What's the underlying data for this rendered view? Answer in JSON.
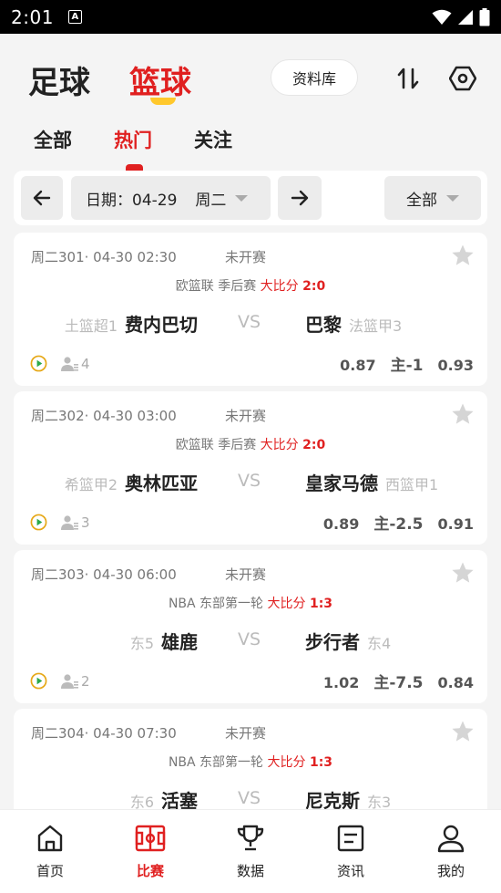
{
  "status_bar": {
    "time": "2:01",
    "notification_glyph": "A"
  },
  "header": {
    "sport_tabs": [
      {
        "label": "足球",
        "active": false
      },
      {
        "label": "篮球",
        "active": true
      }
    ],
    "database_button": "资料库",
    "icons": [
      "sort-icon",
      "settings-hexagon-icon"
    ],
    "sub_tabs": [
      {
        "label": "全部",
        "active": false
      },
      {
        "label": "热门",
        "active": true
      },
      {
        "label": "关注",
        "active": false
      }
    ]
  },
  "date_bar": {
    "date_label": "日期：04-29",
    "weekday": "周二",
    "filter": "全部"
  },
  "matches": [
    {
      "meta": "周二301· 04-30 02:30",
      "status": "未开赛",
      "league": "欧篮联 季后赛",
      "big_small_label": "大比分",
      "big_small_score": "2:0",
      "home_rank": "土篮超1",
      "home_team": "费内巴切",
      "vs": "VS",
      "away_team": "巴黎",
      "away_rank": "法篮甲3",
      "watchers": "4",
      "odds_home": "0.87",
      "handicap_prefix": "主",
      "handicap": "-1",
      "odds_away": "0.93"
    },
    {
      "meta": "周二302· 04-30 03:00",
      "status": "未开赛",
      "league": "欧篮联 季后赛",
      "big_small_label": "大比分",
      "big_small_score": "2:0",
      "home_rank": "希篮甲2",
      "home_team": "奥林匹亚",
      "vs": "VS",
      "away_team": "皇家马德",
      "away_rank": "西篮甲1",
      "watchers": "3",
      "odds_home": "0.89",
      "handicap_prefix": "主",
      "handicap": "-2.5",
      "odds_away": "0.91"
    },
    {
      "meta": "周二303· 04-30 06:00",
      "status": "未开赛",
      "league": "NBA 东部第一轮",
      "big_small_label": "大比分",
      "big_small_score": "1:3",
      "home_rank": "东5",
      "home_team": "雄鹿",
      "vs": "VS",
      "away_team": "步行者",
      "away_rank": "东4",
      "watchers": "2",
      "odds_home": "1.02",
      "handicap_prefix": "主",
      "handicap": "-7.5",
      "odds_away": "0.84"
    },
    {
      "meta": "周二304· 04-30 07:30",
      "status": "未开赛",
      "league": "NBA 东部第一轮",
      "big_small_label": "大比分",
      "big_small_score": "1:3",
      "home_rank": "东6",
      "home_team": "活塞",
      "vs": "VS",
      "away_team": "尼克斯",
      "away_rank": "东3",
      "watchers": "",
      "odds_home": "",
      "handicap_prefix": "",
      "handicap": "",
      "odds_away": ""
    }
  ],
  "tab_bar": [
    {
      "label": "首页",
      "icon": "home-icon",
      "active": false
    },
    {
      "label": "比赛",
      "icon": "court-icon",
      "active": true
    },
    {
      "label": "数据",
      "icon": "trophy-icon",
      "active": false
    },
    {
      "label": "资讯",
      "icon": "news-icon",
      "active": false
    },
    {
      "label": "我的",
      "icon": "profile-icon",
      "active": false
    }
  ],
  "colors": {
    "accent": "#e02020",
    "underline": "#ffc82c",
    "background": "#f4f4f4"
  }
}
